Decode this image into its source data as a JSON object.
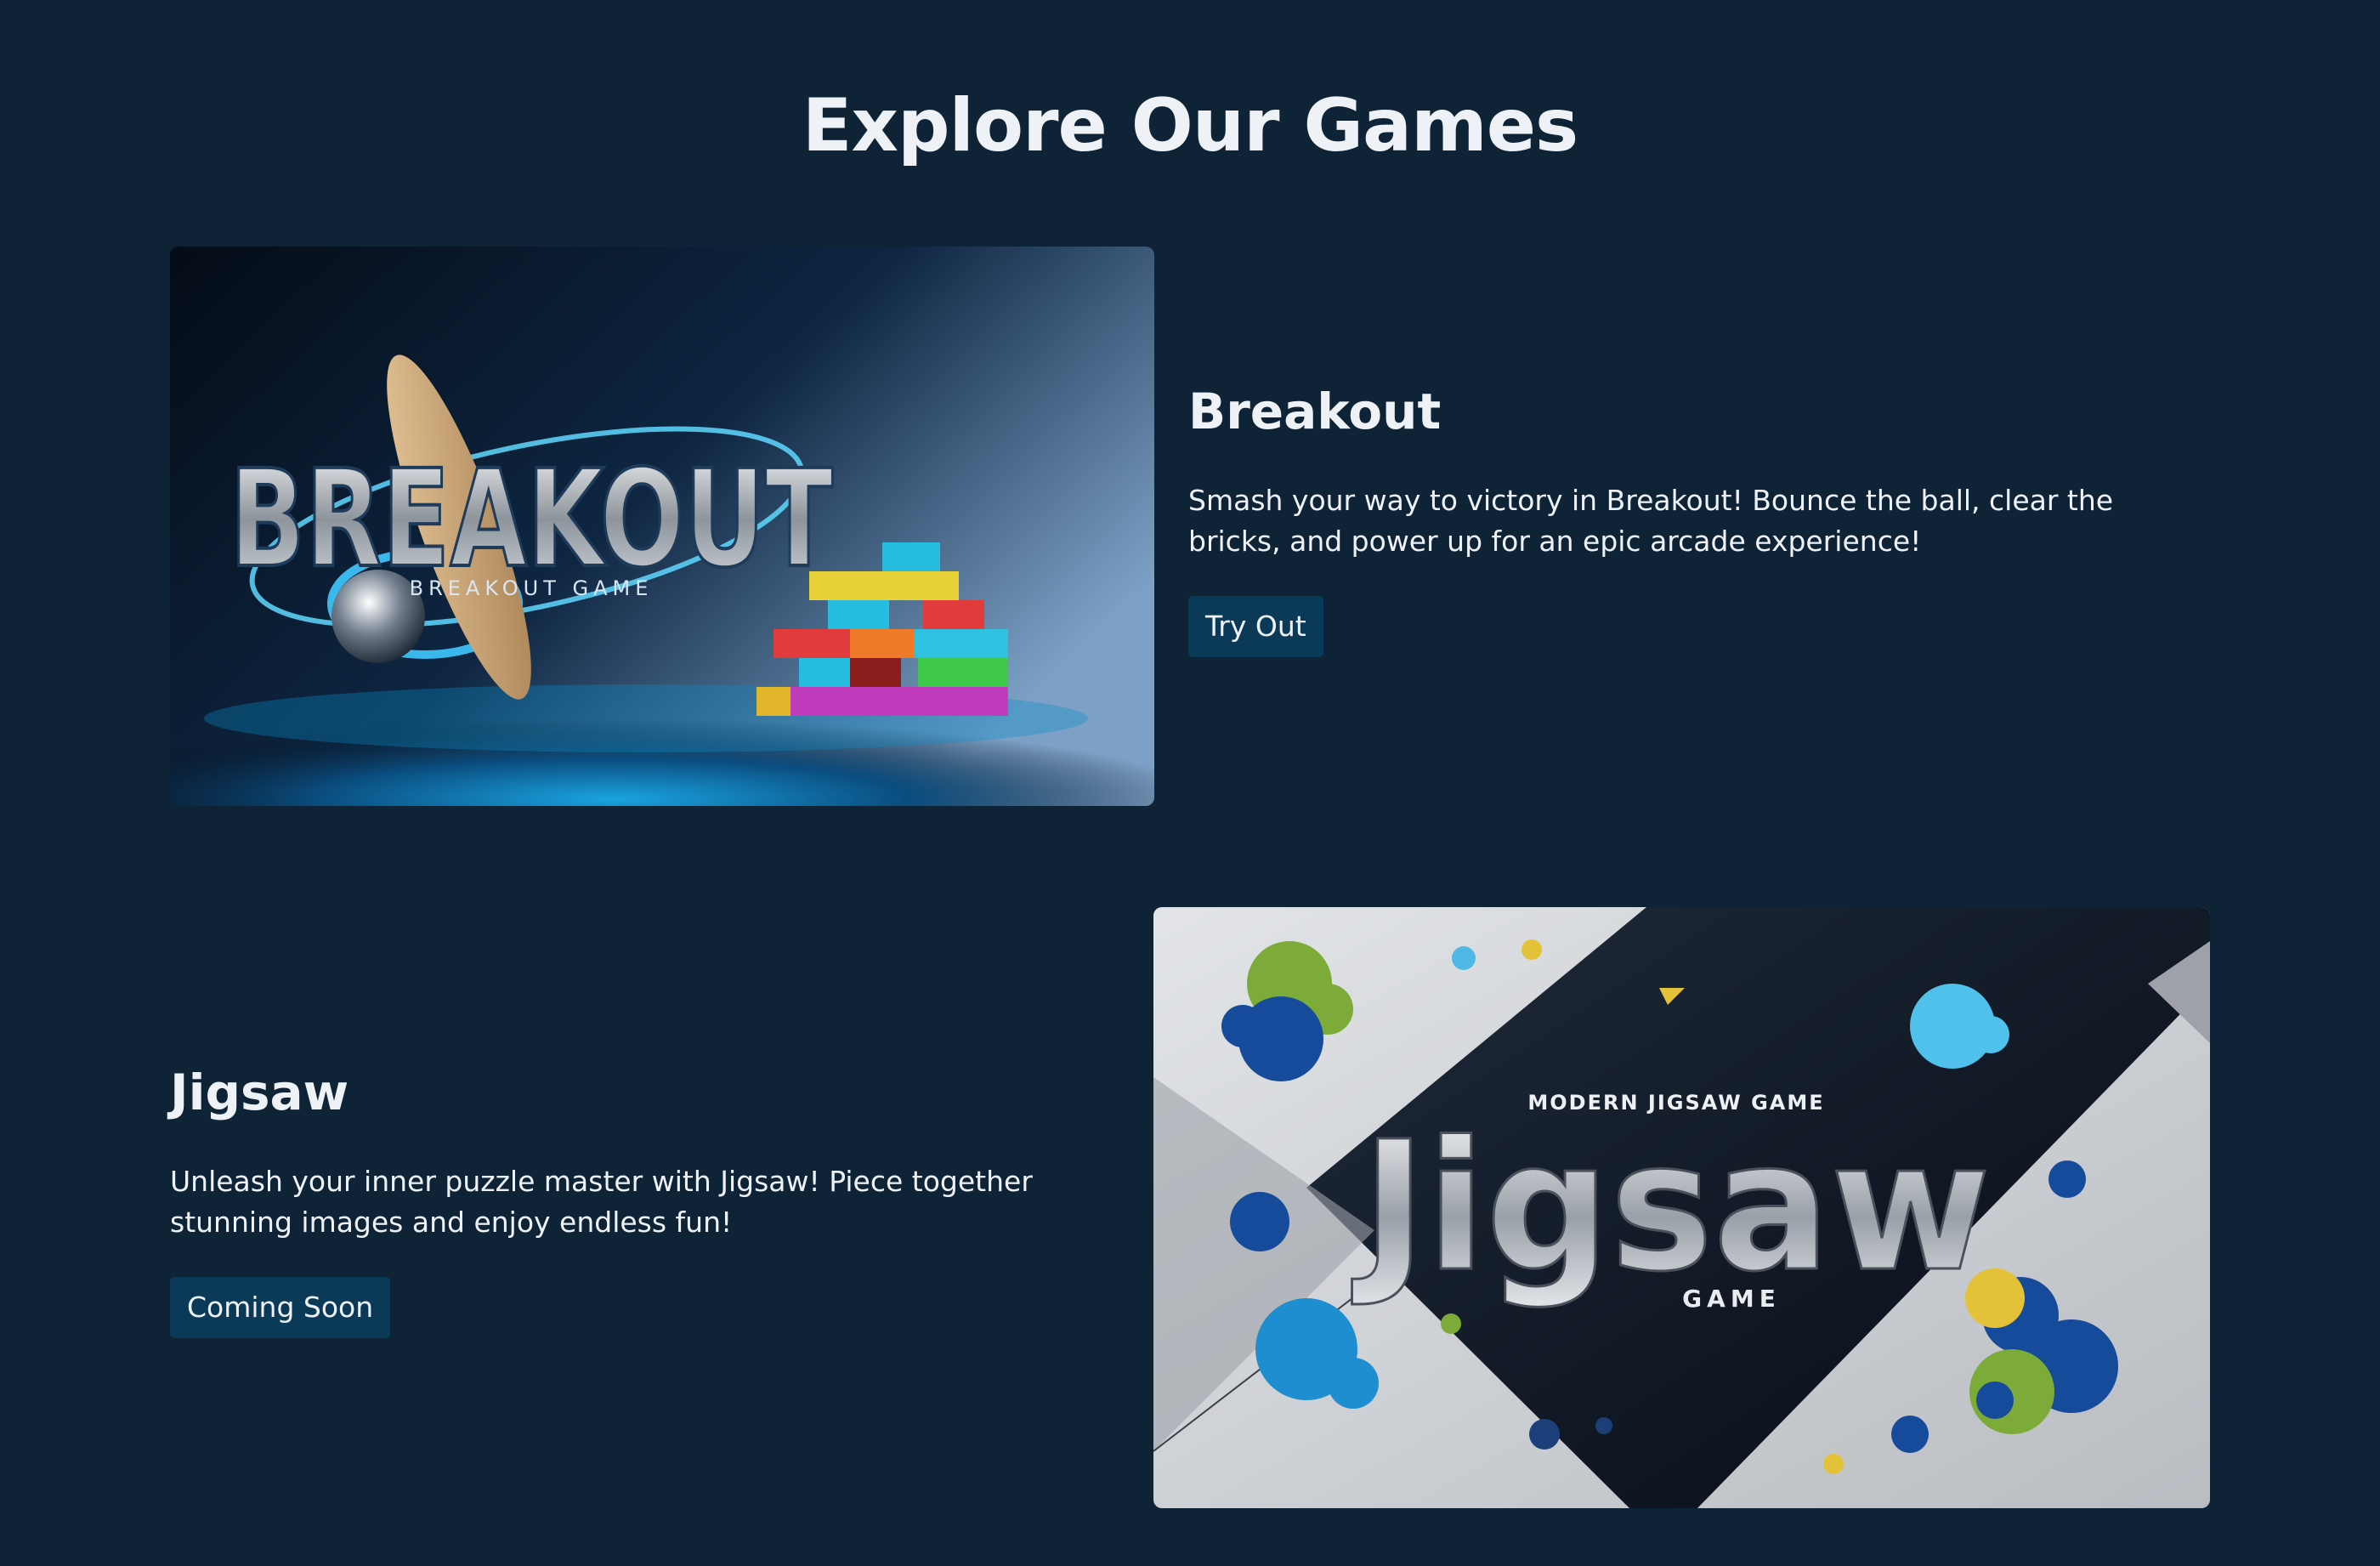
{
  "page": {
    "title": "Explore Our Games",
    "background_color": "#0f2337"
  },
  "games": [
    {
      "title": "Breakout",
      "description": "Smash your way to victory in Breakout! Bounce the ball, clear the bricks, and power up for an epic arcade experience!",
      "button_label": "Try Out",
      "image": {
        "logo_text": "BREAKOUT",
        "subtitle_text": "BREAKOUT GAME"
      }
    },
    {
      "title": "Jigsaw",
      "description": "Unleash your inner puzzle master with Jigsaw! Piece together stunning images and enjoy endless fun!",
      "button_label": "Coming Soon",
      "image": {
        "tagline_text": "MODERN JIGSAW GAME",
        "logo_text": "Jigsaw",
        "subtitle_text": "GAME"
      }
    }
  ],
  "colors": {
    "button_bg": "#0a3a57",
    "text": "#eef2f6"
  }
}
